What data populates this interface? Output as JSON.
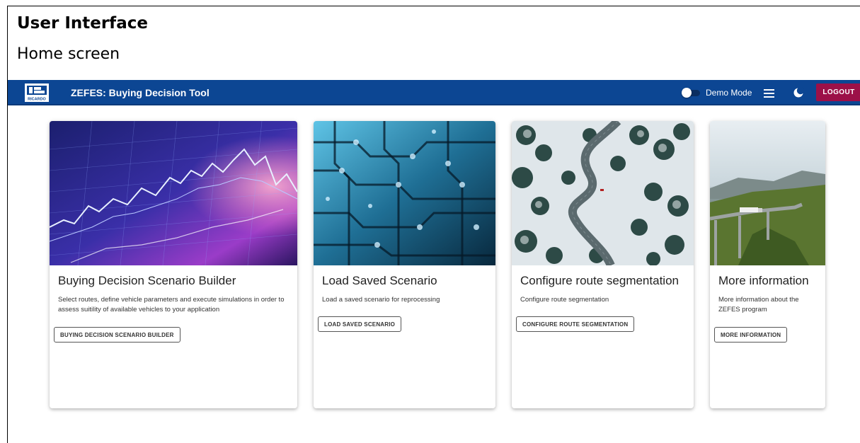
{
  "document": {
    "heading": "User Interface",
    "subheading": "Home screen"
  },
  "appbar": {
    "logo_text": "RICARDO",
    "title": "ZEFES: Buying Decision Tool",
    "demo_mode_label": "Demo Mode",
    "demo_mode_on": false,
    "menu_icon": "hamburger-menu-icon",
    "theme_icon": "moon-icon",
    "logout_label": "LOGOUT"
  },
  "cards": [
    {
      "title": "Buying Decision Scenario Builder",
      "description": "Select routes, define vehicle parameters and execute simulations in order to assess suitility of available vehicles to your application",
      "button_label": "BUYING DECISION SCENARIO BUILDER",
      "image": "financial-chart-image"
    },
    {
      "title": "Load Saved Scenario",
      "description": "Load a saved scenario for reprocessing",
      "button_label": "LOAD SAVED SCENARIO",
      "image": "circuit-board-image"
    },
    {
      "title": "Configure route segmentation",
      "description": "Configure route segmentation",
      "button_label": "CONFIGURE ROUTE SEGMENTATION",
      "image": "winding-road-forest-image"
    },
    {
      "title": "More information",
      "description": "More information about the ZEFES program",
      "button_label": "MORE INFORMATION",
      "image": "truck-on-bridge-image"
    }
  ],
  "colors": {
    "appbar": "#0c4693",
    "logout": "#9c1048"
  }
}
